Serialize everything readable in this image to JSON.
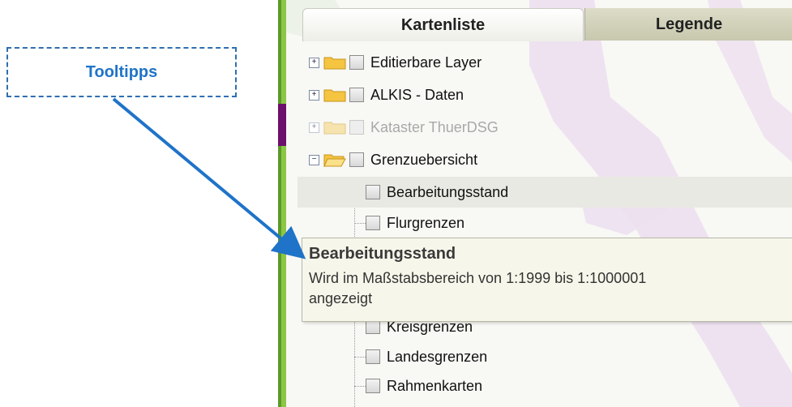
{
  "callout": {
    "label": "Tooltipps"
  },
  "tabs": [
    {
      "label": "Kartenliste",
      "active": true
    },
    {
      "label": "Legende",
      "active": false
    }
  ],
  "tree": [
    {
      "label": "Editierbare Layer",
      "expander": "+",
      "folder": "closed",
      "dimmed": false
    },
    {
      "label": "ALKIS - Daten",
      "expander": "+",
      "folder": "closed",
      "dimmed": false
    },
    {
      "label": "Kataster ThuerDSG",
      "expander": "+",
      "folder": "closed",
      "dimmed": true
    },
    {
      "label": "Grenzuebersicht",
      "expander": "−",
      "folder": "open",
      "dimmed": false
    },
    {
      "label": "Bearbeitungsstand",
      "highlighted": true
    },
    {
      "label": "Flurgrenzen"
    },
    {
      "label": "Kreisgrenzen"
    },
    {
      "label": "Landesgrenzen"
    },
    {
      "label": "Rahmenkarten"
    }
  ],
  "tooltip": {
    "title": "Bearbeitungsstand",
    "body_line1": "Wird im Maßstabsbereich von 1:1999 bis 1:1000001",
    "body_line2": "angezeigt"
  },
  "colors": {
    "accent_blue": "#1f73c8",
    "panel_green": "#8cc645",
    "map_purple": "#e4d3ec"
  }
}
